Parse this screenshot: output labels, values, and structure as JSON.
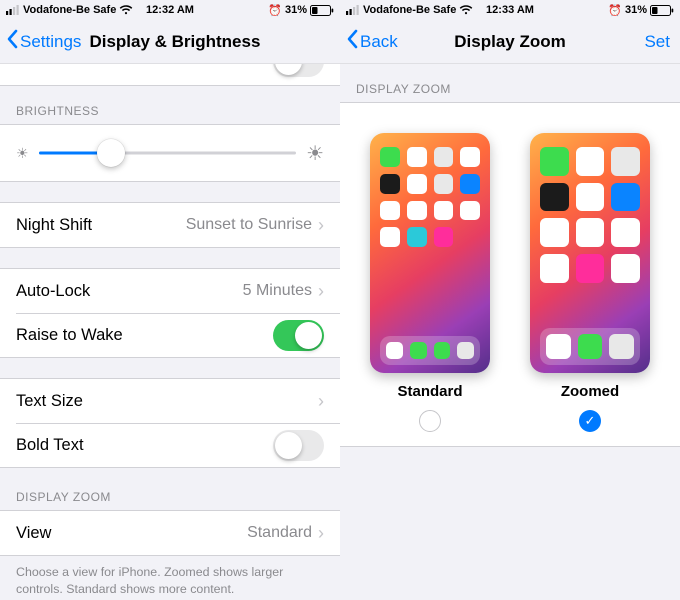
{
  "left": {
    "status": {
      "carrier": "Vodafone-Be Safe",
      "time": "12:32 AM",
      "battery_pct": "31%",
      "alarm": true
    },
    "nav": {
      "back": "Settings",
      "title": "Display & Brightness"
    },
    "sections": {
      "brightness_header": "BRIGHTNESS",
      "brightness_pct": 28,
      "night_shift": {
        "label": "Night Shift",
        "detail": "Sunset to Sunrise"
      },
      "auto_lock": {
        "label": "Auto-Lock",
        "detail": "5 Minutes"
      },
      "raise_to_wake": {
        "label": "Raise to Wake",
        "on": true
      },
      "text_size": {
        "label": "Text Size"
      },
      "bold_text": {
        "label": "Bold Text",
        "on": false
      },
      "zoom_header": "DISPLAY ZOOM",
      "view": {
        "label": "View",
        "detail": "Standard"
      },
      "footer": "Choose a view for iPhone. Zoomed shows larger controls. Standard shows more content."
    }
  },
  "right": {
    "status": {
      "carrier": "Vodafone-Be Safe",
      "time": "12:33 AM",
      "battery_pct": "31%",
      "alarm": true
    },
    "nav": {
      "back": "Back",
      "title": "Display Zoom",
      "action": "Set"
    },
    "header": "DISPLAY ZOOM",
    "options": {
      "standard": "Standard",
      "zoomed": "Zoomed",
      "selected": "zoomed"
    },
    "preview_icons": {
      "standard_rows": [
        [
          "#3ddc4e",
          "#ffffff",
          "#e8e8e8",
          "#ffffff"
        ],
        [
          "#1b1b1b",
          "#ffffff",
          "#e8e8e8",
          "#0a84ff"
        ],
        [
          "#ffffff",
          "#ffffff",
          "#ffffff",
          "#ffffff"
        ],
        [
          "#ffffff",
          "#2bc9d9",
          "#ff2d9b",
          null
        ]
      ],
      "standard_dock": [
        "#ffffff",
        "#3ddc4e",
        "#3ddc4e",
        "#e8e8e8"
      ],
      "zoomed_rows": [
        [
          "#3ddc4e",
          "#ffffff",
          "#e8e8e8"
        ],
        [
          "#1b1b1b",
          "#ffffff",
          "#0a84ff"
        ],
        [
          "#ffffff",
          "#ffffff",
          "#ffffff"
        ],
        [
          "#ffffff",
          "#ff2d9b",
          "#ffffff"
        ]
      ],
      "zoomed_dock": [
        "#ffffff",
        "#3ddc4e",
        "#e8e8e8"
      ]
    }
  }
}
